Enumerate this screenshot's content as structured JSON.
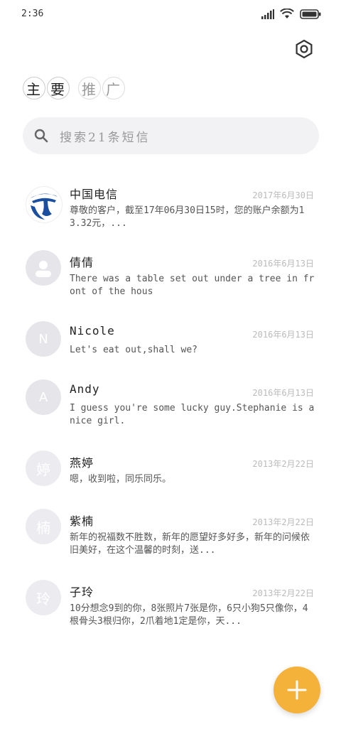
{
  "status_bar": {
    "time": "2:36"
  },
  "header": {
    "tabs": [
      {
        "label": "主要",
        "chars": [
          "主",
          "要"
        ]
      },
      {
        "label": "推广",
        "chars": [
          "推",
          "广"
        ]
      }
    ]
  },
  "search": {
    "placeholder": "搜索21条短信"
  },
  "conversations": [
    {
      "name": "中国电信",
      "date": "2017年6月30日",
      "preview": "尊敬的客户，截至17年06月30日15时，您的账户余额为13.32元，...",
      "avatar": "telecom-logo"
    },
    {
      "name": "倩倩",
      "date": "2016年6月13日",
      "preview": "There was a table set out under a tree in front of the hous",
      "avatar": "person-icon"
    },
    {
      "name": "Nicole",
      "date": "2016年6月13日",
      "preview": "Let's eat out,shall we?",
      "avatar_letter": "N"
    },
    {
      "name": "Andy",
      "date": "2016年6月13日",
      "preview": "I guess you're some lucky guy.Stephanie is a nice girl.",
      "avatar_letter": "A"
    },
    {
      "name": "燕婷",
      "date": "2013年2月22日",
      "preview": "嗯，收到啦，同乐同乐。",
      "avatar_letter": "婷"
    },
    {
      "name": "紫楠",
      "date": "2013年2月22日",
      "preview": "新年的祝福数不胜数，新年的愿望好多好多，新年的问候依旧美好，在这个温馨的时刻，送...",
      "avatar_letter": "楠"
    },
    {
      "name": "子玲",
      "date": "2013年2月22日",
      "preview": "10分想念9到的你，8张照片7张是你，6只小狗5只像你，4根骨头3根归你，2爪着地1定是你，天...",
      "avatar_letter": "玲"
    }
  ],
  "colors": {
    "fab": "#f5b23a",
    "telecom_blue": "#1a4fa0"
  }
}
